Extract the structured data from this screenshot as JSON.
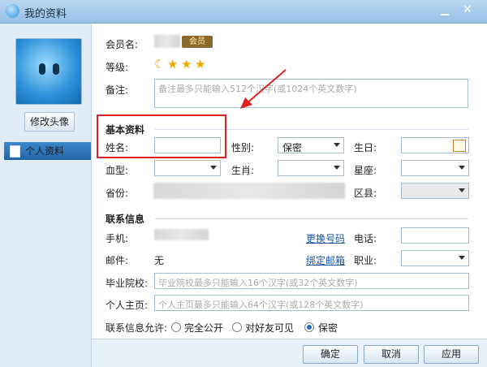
{
  "window": {
    "title": "我的资料"
  },
  "sidebar": {
    "edit_avatar": "修改头像",
    "items": [
      {
        "label": "个人资料"
      }
    ]
  },
  "member": {
    "label": "会员名:",
    "badge": "会员"
  },
  "level": {
    "label": "等级:"
  },
  "note": {
    "label": "备注:",
    "placeholder": "备注最多只能输入512个汉字(或1024个英文数字)"
  },
  "basic": {
    "title": "基本资料",
    "name_label": "姓名:",
    "gender_label": "性别:",
    "gender_value": "保密",
    "birthday_label": "生日:",
    "blood_label": "血型:",
    "zodiac_label": "生肖:",
    "constellation_label": "星座:",
    "province_label": "省份:",
    "district_label": "区县:"
  },
  "contact": {
    "title": "联系信息",
    "mobile_label": "手机:",
    "change_number": "更换号码",
    "phone_label": "电话:",
    "mail_label": "邮件:",
    "mail_value": "无",
    "bind_mail": "绑定邮箱",
    "job_label": "职业:",
    "school_label": "毕业院校:",
    "school_placeholder": "毕业院校最多只能输入16个汉字(或32个英文数字)",
    "homepage_label": "个人主页:",
    "homepage_placeholder": "个人主页最多只能输入64个汉字(或128个英文数字)",
    "visibility_label": "联系信息允许:",
    "options": [
      "完全公开",
      "对好友可见",
      "保密"
    ],
    "selected": "保密"
  },
  "buttons": {
    "ok": "确定",
    "cancel": "取消",
    "apply": "应用"
  }
}
